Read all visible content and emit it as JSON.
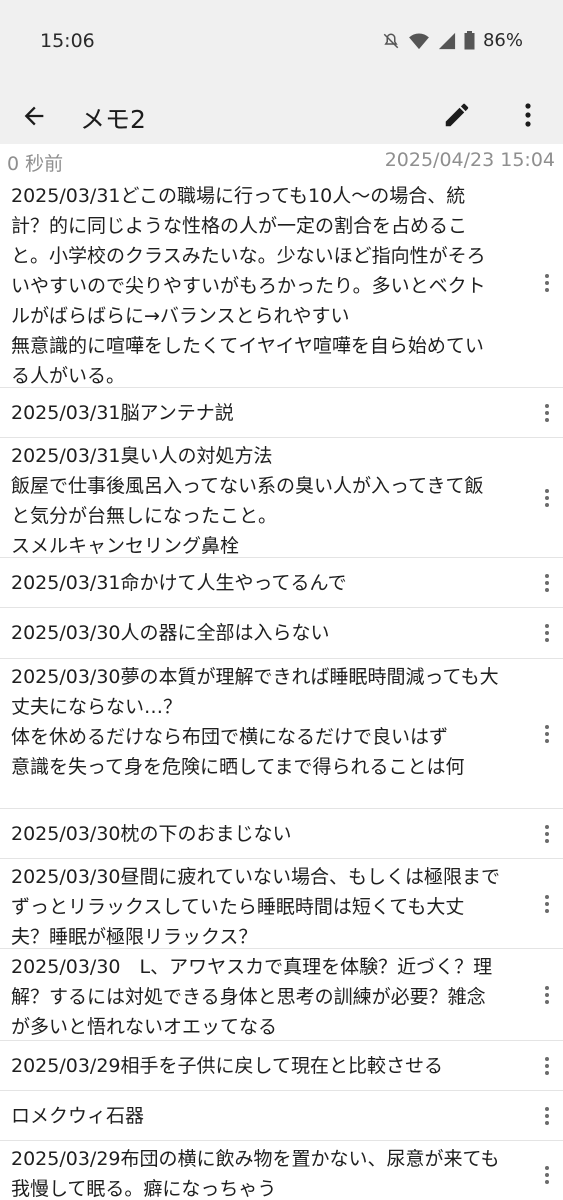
{
  "status_bar": {
    "time": "15:06",
    "battery": "86%",
    "icons": [
      "mute-icon",
      "wifi-icon",
      "signal-icon",
      "battery-icon"
    ]
  },
  "app_bar": {
    "title": "メモ2",
    "icons": [
      "back-arrow-icon",
      "pencil-icon",
      "more-vert-icon"
    ]
  },
  "meta": {
    "relative_time": "0 秒前",
    "timestamp": "2025/04/23 15:04"
  },
  "memos": [
    {
      "text": "2025/03/31どこの職場に行っても10人〜の場合、統計？的に同じような性格の人が一定の割合を占めること。小学校のクラスみたいな。少ないほど指向性がそろいやすいので尖りやすいがもろかったり。多いとベクトルがばらばらに→バランスとられやすい\n無意識的に喧嘩をしたくてイヤイヤ喧嘩を自ら始めている人がいる。"
    },
    {
      "text": "2025/03/31脳アンテナ説"
    },
    {
      "text": "2025/03/31臭い人の対処方法\n飯屋で仕事後風呂入ってない系の臭い人が入ってきて飯と気分が台無しになったこと。\nスメルキャンセリング鼻栓"
    },
    {
      "text": "2025/03/31命かけて人生やってるんで"
    },
    {
      "text": "2025/03/30人の器に全部は入らない"
    },
    {
      "text": "2025/03/30夢の本質が理解できれば睡眠時間減っても大丈夫にならない…？\n体を休めるだけなら布団で横になるだけで良いはず\n意識を失って身を危険に晒してまで得られることは何"
    },
    {
      "text": "2025/03/30枕の下のおまじない"
    },
    {
      "text": "2025/03/30昼間に疲れていない場合、もしくは極限までずっとリラックスしていたら睡眠時間は短くても大丈夫？睡眠が極限リラックス？"
    },
    {
      "text": "2025/03/30　L、アワヤスカで真理を体験？近づく？理解？するには対処できる身体と思考の訓練が必要？雑念が多いと悟れないオエッてなる"
    },
    {
      "text": "2025/03/29相手を子供に戻して現在と比較させる"
    },
    {
      "text": "ロメクウィ石器"
    },
    {
      "text": "2025/03/29布団の横に飲み物を置かない、尿意が来ても我慢して眠る。癖になっちゃう"
    }
  ]
}
